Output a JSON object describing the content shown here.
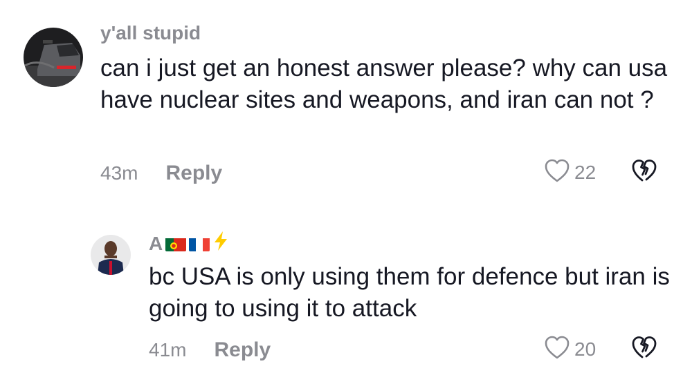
{
  "comments": [
    {
      "username": "y'all stupid",
      "text": "can i just get an honest answer please? why can usa have nuclear sites and weapons, and iran can not ?",
      "time": "43m",
      "reply_label": "Reply",
      "likes": "22"
    },
    {
      "username_prefix": "A",
      "username_emojis": [
        "portugal-flag-emoji",
        "france-flag-emoji",
        "lightning-emoji"
      ],
      "text": "bc USA is only using them for defence but iran is going to using it to attack",
      "time": "41m",
      "reply_label": "Reply",
      "likes": "20"
    }
  ],
  "colors": {
    "muted": "#8a8b91",
    "text": "#161823",
    "background": "#ffffff"
  }
}
